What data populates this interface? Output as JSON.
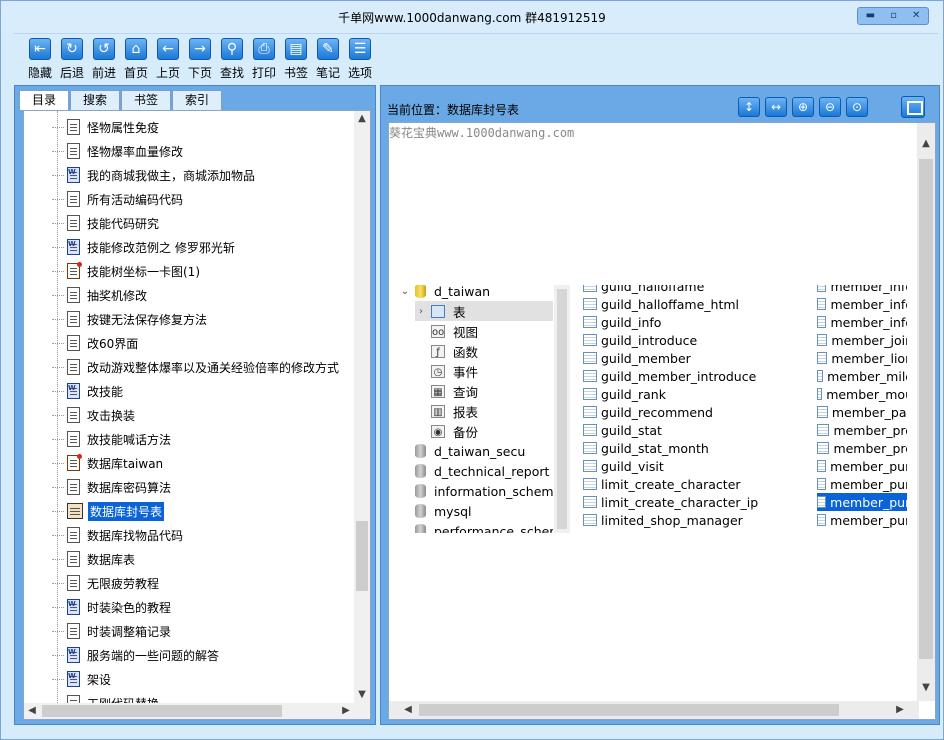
{
  "window": {
    "title": "千单网www.1000danwang.com 群481912519",
    "controls": [
      "▬",
      "▫",
      "✕"
    ]
  },
  "toolbar": [
    {
      "label": "隐藏",
      "icon": "hide-icon",
      "glyph": "⇤"
    },
    {
      "label": "后退",
      "icon": "back-icon",
      "glyph": "↻"
    },
    {
      "label": "前进",
      "icon": "forward-icon",
      "glyph": "↺"
    },
    {
      "label": "首页",
      "icon": "home-icon",
      "glyph": "⌂"
    },
    {
      "label": "上页",
      "icon": "prev-page-icon",
      "glyph": "←"
    },
    {
      "label": "下页",
      "icon": "next-page-icon",
      "glyph": "→"
    },
    {
      "label": "查找",
      "icon": "search-icon",
      "glyph": "⚲"
    },
    {
      "label": "打印",
      "icon": "print-icon",
      "glyph": "⎙"
    },
    {
      "label": "书签",
      "icon": "bookmark-icon",
      "glyph": "▤"
    },
    {
      "label": "笔记",
      "icon": "note-icon",
      "glyph": "✎"
    },
    {
      "label": "选项",
      "icon": "options-icon",
      "glyph": "☰"
    }
  ],
  "tabs": [
    "目录",
    "搜索",
    "书签",
    "索引"
  ],
  "tree_items": [
    {
      "label": "怪物属性免疫",
      "type": "doc"
    },
    {
      "label": "怪物爆率血量修改",
      "type": "doc"
    },
    {
      "label": "我的商城我做主，商城添加物品",
      "type": "word"
    },
    {
      "label": "所有活动编码代码",
      "type": "doc"
    },
    {
      "label": "技能代码研究",
      "type": "doc"
    },
    {
      "label": "技能修改范例之 修罗邪光斩",
      "type": "word"
    },
    {
      "label": "技能树坐标一卡图(1)",
      "type": "excel"
    },
    {
      "label": "抽奖机修改",
      "type": "doc"
    },
    {
      "label": "按键无法保存修复方法",
      "type": "doc"
    },
    {
      "label": "改60界面",
      "type": "doc"
    },
    {
      "label": "改动游戏整体爆率以及通关经验倍率的修改方式",
      "type": "doc"
    },
    {
      "label": "改技能",
      "type": "word"
    },
    {
      "label": "攻击换装",
      "type": "doc"
    },
    {
      "label": "放技能喊话方法",
      "type": "doc"
    },
    {
      "label": "数据库taiwan",
      "type": "excel"
    },
    {
      "label": "数据库密码算法",
      "type": "doc"
    },
    {
      "label": "数据库封号表",
      "type": "book",
      "selected": true
    },
    {
      "label": "数据库找物品代码",
      "type": "doc"
    },
    {
      "label": "数据库表",
      "type": "doc"
    },
    {
      "label": "无限疲劳教程",
      "type": "doc"
    },
    {
      "label": "时装染色的教程",
      "type": "word"
    },
    {
      "label": "时装调整箱记录",
      "type": "doc"
    },
    {
      "label": "服务端的一些问题的解答",
      "type": "word"
    },
    {
      "label": "架设",
      "type": "word"
    },
    {
      "label": "工刚代码替换",
      "type": "doc"
    }
  ],
  "right_toolbar": [
    "↕",
    "↔",
    "⊕",
    "⊖",
    "⊙"
  ],
  "current_position": {
    "label": "当前位置：",
    "value": "数据库封号表"
  },
  "watermark": "葵花宝典www.1000danwang.com",
  "db_tree": [
    {
      "label": "d_taiwan",
      "kind": "db-open"
    },
    {
      "label": "表",
      "kind": "tables",
      "highlight": true
    },
    {
      "label": "视图",
      "kind": "views",
      "glyph": "oo"
    },
    {
      "label": "函数",
      "kind": "functions",
      "glyph": "ƒ"
    },
    {
      "label": "事件",
      "kind": "events",
      "glyph": "◷"
    },
    {
      "label": "查询",
      "kind": "queries",
      "glyph": "▦"
    },
    {
      "label": "报表",
      "kind": "reports",
      "glyph": "▥"
    },
    {
      "label": "备份",
      "kind": "backup",
      "glyph": "◉"
    },
    {
      "label": "d_taiwan_secu",
      "kind": "db"
    },
    {
      "label": "d_technical_report",
      "kind": "db"
    },
    {
      "label": "information_schema",
      "kind": "db"
    },
    {
      "label": "mysql",
      "kind": "db"
    },
    {
      "label": "performance_schema",
      "kind": "db"
    }
  ],
  "table_list_col1": [
    "guild_halloffame",
    "guild_halloffame_html",
    "guild_info",
    "guild_introduce",
    "guild_member",
    "guild_member_introduce",
    "guild_rank",
    "guild_recommend",
    "guild_stat",
    "guild_stat_month",
    "guild_visit",
    "limit_create_character",
    "limit_create_character_ip",
    "limited_shop_manager"
  ],
  "table_list_col2": [
    "member_info",
    "member_info",
    "member_info",
    "member_join",
    "member_lion",
    "member_mile",
    "member_mou",
    "member_pas",
    "member_pre",
    "member_pre",
    "member_pun",
    "member_pun",
    "member_pun",
    "member_pun"
  ],
  "table_list_col2_selected": 12
}
